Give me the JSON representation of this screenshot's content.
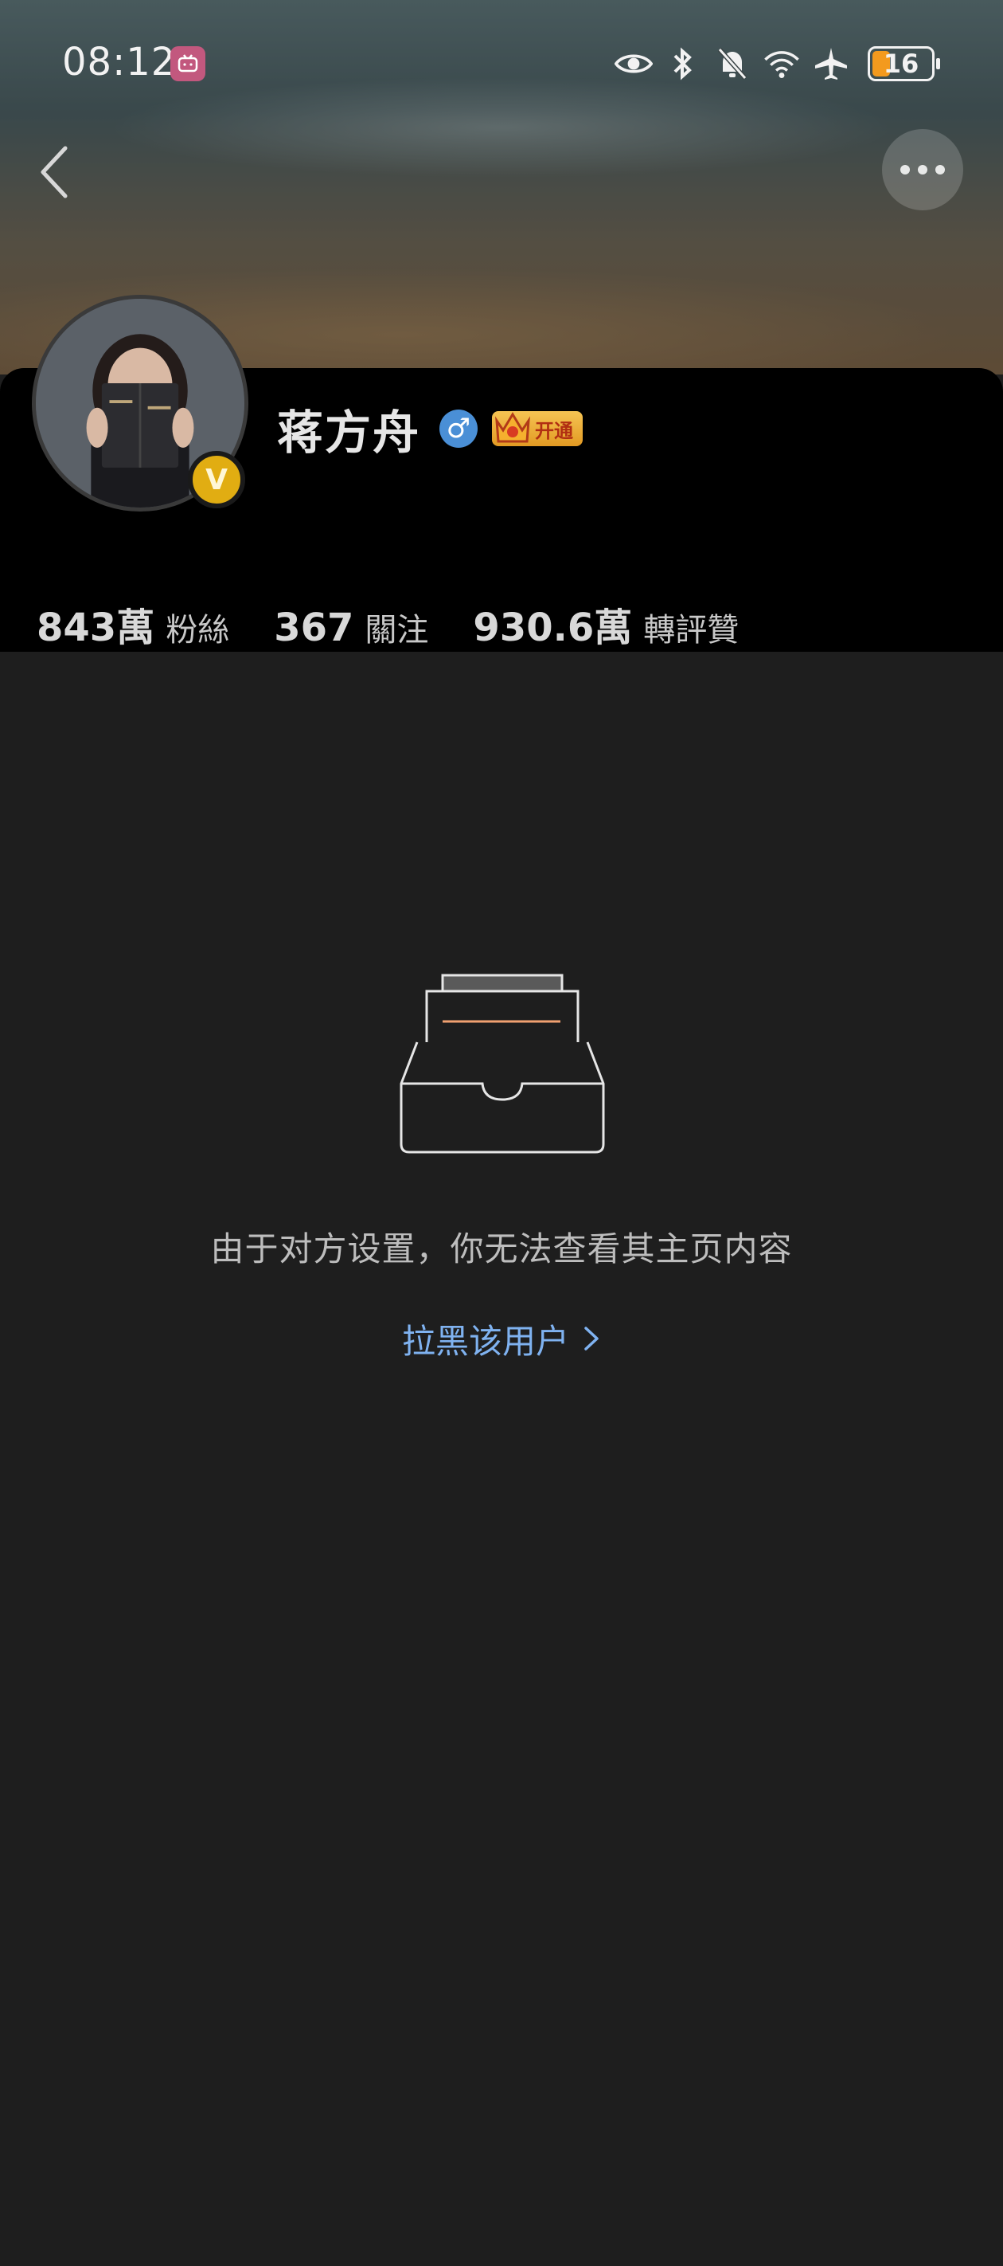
{
  "status_bar": {
    "time": "08:12",
    "battery_level": "16",
    "icons": [
      "tv-app-icon",
      "eye-icon",
      "bluetooth-icon",
      "bell-off-icon",
      "wifi-icon",
      "airplane-icon",
      "battery-icon"
    ]
  },
  "nav": {
    "back_icon": "chevron-left-icon",
    "more_icon": "more-dots-icon"
  },
  "profile": {
    "name": "蒋方舟",
    "verified_badge": "V",
    "gender_symbol": "♂",
    "vip_label": "开通",
    "stats": [
      {
        "value": "843萬",
        "label": "粉絲"
      },
      {
        "value": "367",
        "label": "關注"
      },
      {
        "value": "930.6萬",
        "label": "轉評贊"
      }
    ]
  },
  "empty_state": {
    "message": "由于对方设置，你无法查看其主页内容",
    "action_label": "拉黑该用户"
  },
  "colors": {
    "background": "#1e1e1e",
    "card": "#000000",
    "link": "#7fb2f0",
    "verified": "#e1ad12",
    "gender": "#4a8fd6"
  }
}
